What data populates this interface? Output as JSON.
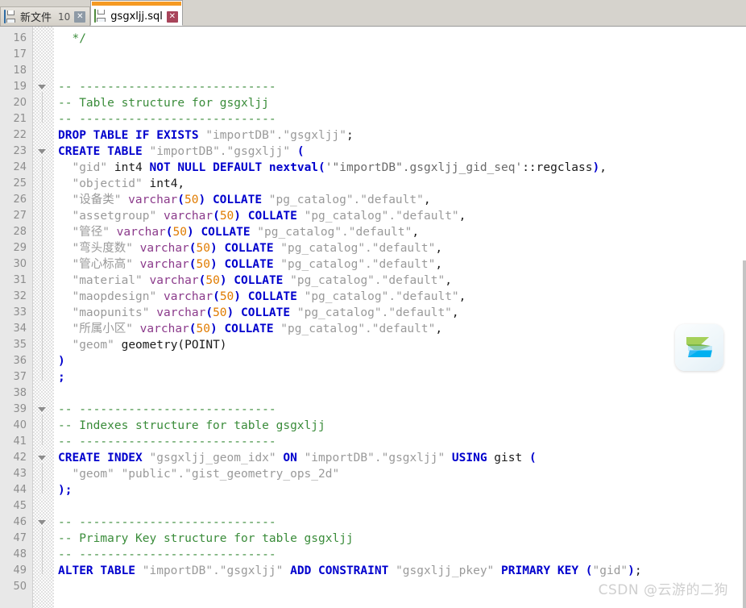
{
  "window": {
    "title": "gsgxljj.sql",
    "accent_color": "#f59a23"
  },
  "tabs": [
    {
      "label": "新文件",
      "number": "10",
      "icon": "floppy-disk-icon",
      "close_icon": "close-icon",
      "active": false
    },
    {
      "label": "gsgxljj.sql",
      "number": "",
      "icon": "floppy-disk-icon",
      "close_icon": "close-icon",
      "active": true
    }
  ],
  "editor": {
    "first_line_number": 16,
    "last_line_number": 50,
    "line_height": 20,
    "colors": {
      "keyword": "#0000cd",
      "comment": "#3a8c3a",
      "identifier": "#9a9a9a",
      "type": "#8b3a8b",
      "number": "#e07b00",
      "string": "#6b6b6b",
      "plain": "#1a1a1a",
      "gutter_bg": "#e8e8e8",
      "editor_bg": "#ffffff"
    },
    "lines": [
      {
        "n": 16,
        "fold": false,
        "tokens": [
          {
            "t": "  ",
            "c": "pl"
          },
          {
            "t": "*/",
            "c": "c"
          }
        ]
      },
      {
        "n": 17,
        "fold": false,
        "tokens": []
      },
      {
        "n": 18,
        "fold": false,
        "tokens": []
      },
      {
        "n": 19,
        "fold": true,
        "tokens": [
          {
            "t": "-- ----------------------------",
            "c": "c"
          }
        ]
      },
      {
        "n": 20,
        "fold": false,
        "tokens": [
          {
            "t": "-- Table structure for gsgxljj",
            "c": "c"
          }
        ]
      },
      {
        "n": 21,
        "fold": false,
        "tokens": [
          {
            "t": "-- ----------------------------",
            "c": "c"
          }
        ]
      },
      {
        "n": 22,
        "fold": false,
        "tokens": [
          {
            "t": "DROP TABLE IF EXISTS ",
            "c": "k"
          },
          {
            "t": "\"importDB\".\"gsgxljj\"",
            "c": "id"
          },
          {
            "t": ";",
            "c": "pl"
          }
        ]
      },
      {
        "n": 23,
        "fold": true,
        "tokens": [
          {
            "t": "CREATE TABLE ",
            "c": "k"
          },
          {
            "t": "\"importDB\".\"gsgxljj\"",
            "c": "id"
          },
          {
            "t": " ",
            "c": "pl"
          },
          {
            "t": "(",
            "c": "k"
          }
        ]
      },
      {
        "n": 24,
        "fold": false,
        "tokens": [
          {
            "t": "  ",
            "c": "pl"
          },
          {
            "t": "\"gid\"",
            "c": "id"
          },
          {
            "t": " int4 ",
            "c": "pl"
          },
          {
            "t": "NOT NULL DEFAULT nextval",
            "c": "k"
          },
          {
            "t": "(",
            "c": "k"
          },
          {
            "t": "'\"importDB\".gsgxljj_gid_seq'",
            "c": "str"
          },
          {
            "t": "::regclass",
            "c": "pl"
          },
          {
            "t": ")",
            "c": "k"
          },
          {
            "t": ",",
            "c": "pl"
          }
        ]
      },
      {
        "n": 25,
        "fold": false,
        "tokens": [
          {
            "t": "  ",
            "c": "pl"
          },
          {
            "t": "\"objectid\"",
            "c": "id"
          },
          {
            "t": " int4,",
            "c": "pl"
          }
        ]
      },
      {
        "n": 26,
        "fold": false,
        "tokens": [
          {
            "t": "  ",
            "c": "pl"
          },
          {
            "t": "\"设备类\"",
            "c": "id"
          },
          {
            "t": " ",
            "c": "pl"
          },
          {
            "t": "varchar",
            "c": "ty"
          },
          {
            "t": "(",
            "c": "k"
          },
          {
            "t": "50",
            "c": "nu"
          },
          {
            "t": ")",
            "c": "k"
          },
          {
            "t": " ",
            "c": "pl"
          },
          {
            "t": "COLLATE",
            "c": "k"
          },
          {
            "t": " ",
            "c": "pl"
          },
          {
            "t": "\"pg_catalog\".\"default\"",
            "c": "id"
          },
          {
            "t": ",",
            "c": "pl"
          }
        ]
      },
      {
        "n": 27,
        "fold": false,
        "tokens": [
          {
            "t": "  ",
            "c": "pl"
          },
          {
            "t": "\"assetgroup\"",
            "c": "id"
          },
          {
            "t": " ",
            "c": "pl"
          },
          {
            "t": "varchar",
            "c": "ty"
          },
          {
            "t": "(",
            "c": "k"
          },
          {
            "t": "50",
            "c": "nu"
          },
          {
            "t": ")",
            "c": "k"
          },
          {
            "t": " ",
            "c": "pl"
          },
          {
            "t": "COLLATE",
            "c": "k"
          },
          {
            "t": " ",
            "c": "pl"
          },
          {
            "t": "\"pg_catalog\".\"default\"",
            "c": "id"
          },
          {
            "t": ",",
            "c": "pl"
          }
        ]
      },
      {
        "n": 28,
        "fold": false,
        "tokens": [
          {
            "t": "  ",
            "c": "pl"
          },
          {
            "t": "\"管径\"",
            "c": "id"
          },
          {
            "t": " ",
            "c": "pl"
          },
          {
            "t": "varchar",
            "c": "ty"
          },
          {
            "t": "(",
            "c": "k"
          },
          {
            "t": "50",
            "c": "nu"
          },
          {
            "t": ")",
            "c": "k"
          },
          {
            "t": " ",
            "c": "pl"
          },
          {
            "t": "COLLATE",
            "c": "k"
          },
          {
            "t": " ",
            "c": "pl"
          },
          {
            "t": "\"pg_catalog\".\"default\"",
            "c": "id"
          },
          {
            "t": ",",
            "c": "pl"
          }
        ]
      },
      {
        "n": 29,
        "fold": false,
        "tokens": [
          {
            "t": "  ",
            "c": "pl"
          },
          {
            "t": "\"弯头度数\"",
            "c": "id"
          },
          {
            "t": " ",
            "c": "pl"
          },
          {
            "t": "varchar",
            "c": "ty"
          },
          {
            "t": "(",
            "c": "k"
          },
          {
            "t": "50",
            "c": "nu"
          },
          {
            "t": ")",
            "c": "k"
          },
          {
            "t": " ",
            "c": "pl"
          },
          {
            "t": "COLLATE",
            "c": "k"
          },
          {
            "t": " ",
            "c": "pl"
          },
          {
            "t": "\"pg_catalog\".\"default\"",
            "c": "id"
          },
          {
            "t": ",",
            "c": "pl"
          }
        ]
      },
      {
        "n": 30,
        "fold": false,
        "tokens": [
          {
            "t": "  ",
            "c": "pl"
          },
          {
            "t": "\"管心标高\"",
            "c": "id"
          },
          {
            "t": " ",
            "c": "pl"
          },
          {
            "t": "varchar",
            "c": "ty"
          },
          {
            "t": "(",
            "c": "k"
          },
          {
            "t": "50",
            "c": "nu"
          },
          {
            "t": ")",
            "c": "k"
          },
          {
            "t": " ",
            "c": "pl"
          },
          {
            "t": "COLLATE",
            "c": "k"
          },
          {
            "t": " ",
            "c": "pl"
          },
          {
            "t": "\"pg_catalog\".\"default\"",
            "c": "id"
          },
          {
            "t": ",",
            "c": "pl"
          }
        ]
      },
      {
        "n": 31,
        "fold": false,
        "tokens": [
          {
            "t": "  ",
            "c": "pl"
          },
          {
            "t": "\"material\"",
            "c": "id"
          },
          {
            "t": " ",
            "c": "pl"
          },
          {
            "t": "varchar",
            "c": "ty"
          },
          {
            "t": "(",
            "c": "k"
          },
          {
            "t": "50",
            "c": "nu"
          },
          {
            "t": ")",
            "c": "k"
          },
          {
            "t": " ",
            "c": "pl"
          },
          {
            "t": "COLLATE",
            "c": "k"
          },
          {
            "t": " ",
            "c": "pl"
          },
          {
            "t": "\"pg_catalog\".\"default\"",
            "c": "id"
          },
          {
            "t": ",",
            "c": "pl"
          }
        ]
      },
      {
        "n": 32,
        "fold": false,
        "tokens": [
          {
            "t": "  ",
            "c": "pl"
          },
          {
            "t": "\"maopdesign\"",
            "c": "id"
          },
          {
            "t": " ",
            "c": "pl"
          },
          {
            "t": "varchar",
            "c": "ty"
          },
          {
            "t": "(",
            "c": "k"
          },
          {
            "t": "50",
            "c": "nu"
          },
          {
            "t": ")",
            "c": "k"
          },
          {
            "t": " ",
            "c": "pl"
          },
          {
            "t": "COLLATE",
            "c": "k"
          },
          {
            "t": " ",
            "c": "pl"
          },
          {
            "t": "\"pg_catalog\".\"default\"",
            "c": "id"
          },
          {
            "t": ",",
            "c": "pl"
          }
        ]
      },
      {
        "n": 33,
        "fold": false,
        "tokens": [
          {
            "t": "  ",
            "c": "pl"
          },
          {
            "t": "\"maopunits\"",
            "c": "id"
          },
          {
            "t": " ",
            "c": "pl"
          },
          {
            "t": "varchar",
            "c": "ty"
          },
          {
            "t": "(",
            "c": "k"
          },
          {
            "t": "50",
            "c": "nu"
          },
          {
            "t": ")",
            "c": "k"
          },
          {
            "t": " ",
            "c": "pl"
          },
          {
            "t": "COLLATE",
            "c": "k"
          },
          {
            "t": " ",
            "c": "pl"
          },
          {
            "t": "\"pg_catalog\".\"default\"",
            "c": "id"
          },
          {
            "t": ",",
            "c": "pl"
          }
        ]
      },
      {
        "n": 34,
        "fold": false,
        "tokens": [
          {
            "t": "  ",
            "c": "pl"
          },
          {
            "t": "\"所属小区\"",
            "c": "id"
          },
          {
            "t": " ",
            "c": "pl"
          },
          {
            "t": "varchar",
            "c": "ty"
          },
          {
            "t": "(",
            "c": "k"
          },
          {
            "t": "50",
            "c": "nu"
          },
          {
            "t": ")",
            "c": "k"
          },
          {
            "t": " ",
            "c": "pl"
          },
          {
            "t": "COLLATE",
            "c": "k"
          },
          {
            "t": " ",
            "c": "pl"
          },
          {
            "t": "\"pg_catalog\".\"default\"",
            "c": "id"
          },
          {
            "t": ",",
            "c": "pl"
          }
        ]
      },
      {
        "n": 35,
        "fold": false,
        "tokens": [
          {
            "t": "  ",
            "c": "pl"
          },
          {
            "t": "\"geom\"",
            "c": "id"
          },
          {
            "t": " geometry(POINT)",
            "c": "pl"
          }
        ]
      },
      {
        "n": 36,
        "fold": false,
        "tokens": [
          {
            "t": ")",
            "c": "k"
          }
        ]
      },
      {
        "n": 37,
        "fold": false,
        "tokens": [
          {
            "t": ";",
            "c": "k"
          }
        ]
      },
      {
        "n": 38,
        "fold": false,
        "tokens": []
      },
      {
        "n": 39,
        "fold": true,
        "tokens": [
          {
            "t": "-- ----------------------------",
            "c": "c"
          }
        ]
      },
      {
        "n": 40,
        "fold": false,
        "tokens": [
          {
            "t": "-- Indexes structure for table gsgxljj",
            "c": "c"
          }
        ]
      },
      {
        "n": 41,
        "fold": false,
        "tokens": [
          {
            "t": "-- ----------------------------",
            "c": "c"
          }
        ]
      },
      {
        "n": 42,
        "fold": true,
        "tokens": [
          {
            "t": "CREATE INDEX ",
            "c": "k"
          },
          {
            "t": "\"gsgxljj_geom_idx\"",
            "c": "id"
          },
          {
            "t": " ",
            "c": "pl"
          },
          {
            "t": "ON",
            "c": "k"
          },
          {
            "t": " ",
            "c": "pl"
          },
          {
            "t": "\"importDB\".\"gsgxljj\"",
            "c": "id"
          },
          {
            "t": " ",
            "c": "pl"
          },
          {
            "t": "USING",
            "c": "k"
          },
          {
            "t": " gist ",
            "c": "pl"
          },
          {
            "t": "(",
            "c": "k"
          }
        ]
      },
      {
        "n": 43,
        "fold": false,
        "tokens": [
          {
            "t": "  ",
            "c": "pl"
          },
          {
            "t": "\"geom\" \"public\".\"gist_geometry_ops_2d\"",
            "c": "id"
          }
        ]
      },
      {
        "n": 44,
        "fold": false,
        "tokens": [
          {
            "t": ")",
            "c": "k"
          },
          {
            "t": ";",
            "c": "k"
          }
        ]
      },
      {
        "n": 45,
        "fold": false,
        "tokens": []
      },
      {
        "n": 46,
        "fold": true,
        "tokens": [
          {
            "t": "-- ----------------------------",
            "c": "c"
          }
        ]
      },
      {
        "n": 47,
        "fold": false,
        "tokens": [
          {
            "t": "-- Primary Key structure for table gsgxljj",
            "c": "c"
          }
        ]
      },
      {
        "n": 48,
        "fold": false,
        "tokens": [
          {
            "t": "-- ----------------------------",
            "c": "c"
          }
        ]
      },
      {
        "n": 49,
        "fold": false,
        "tokens": [
          {
            "t": "ALTER TABLE ",
            "c": "k"
          },
          {
            "t": "\"importDB\".\"gsgxljj\"",
            "c": "id"
          },
          {
            "t": " ",
            "c": "pl"
          },
          {
            "t": "ADD CONSTRAINT ",
            "c": "k"
          },
          {
            "t": "\"gsgxljj_pkey\"",
            "c": "id"
          },
          {
            "t": " ",
            "c": "pl"
          },
          {
            "t": "PRIMARY KEY ",
            "c": "k"
          },
          {
            "t": "(",
            "c": "k"
          },
          {
            "t": "\"gid\"",
            "c": "id"
          },
          {
            "t": ")",
            "c": "k"
          },
          {
            "t": ";",
            "c": "pl"
          }
        ]
      },
      {
        "n": 50,
        "fold": false,
        "tokens": []
      }
    ]
  },
  "watermarks": {
    "snipaste_logo": "snipaste-logo-icon",
    "csdn_text": "CSDN @云游的二狗"
  }
}
